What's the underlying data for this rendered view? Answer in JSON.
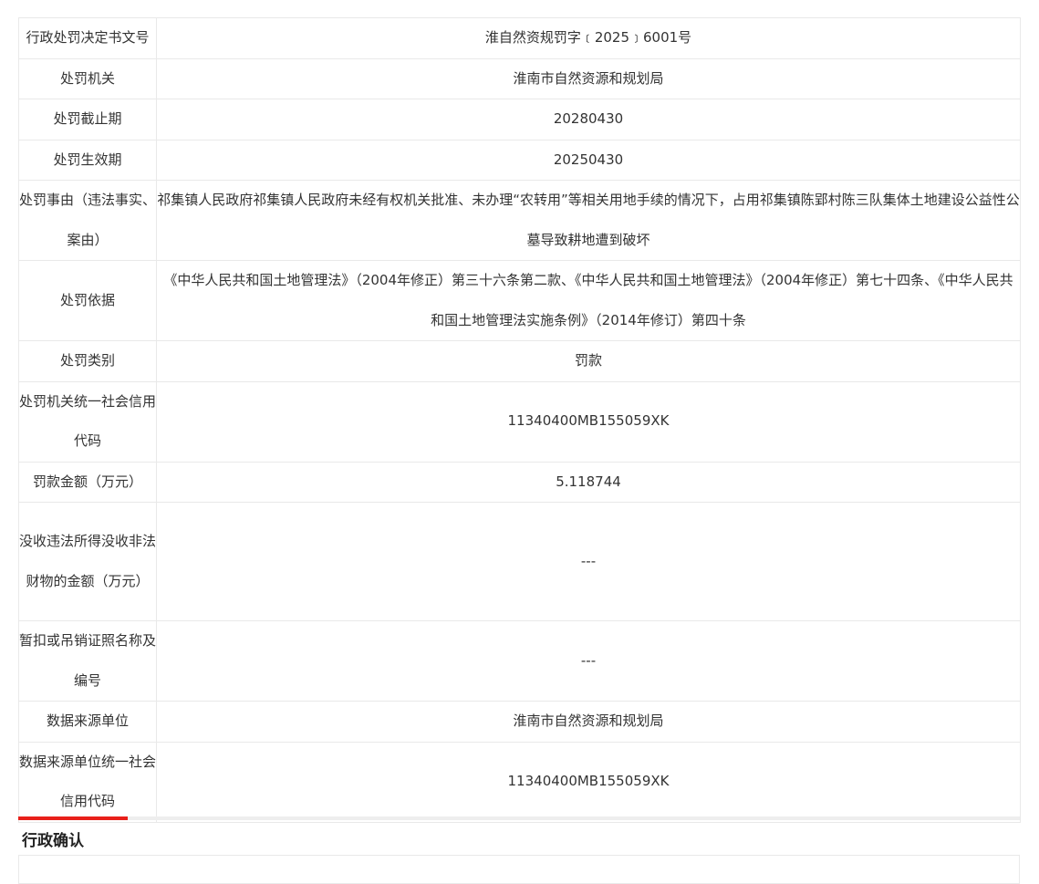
{
  "penalty_table": [
    {
      "label": "行政处罚决定书文号",
      "value": "淮自然资规罚字﹝2025﹞6001号"
    },
    {
      "label": "处罚机关",
      "value": "淮南市自然资源和规划局"
    },
    {
      "label": "处罚截止期",
      "value": "20280430"
    },
    {
      "label": "处罚生效期",
      "value": "20250430"
    },
    {
      "label": "处罚事由（违法事实、案由）",
      "value": "祁集镇人民政府祁集镇人民政府未经有权机关批准、未办理“农转用”等相关用地手续的情况下，占用祁集镇陈郢村陈三队集体土地建设公益性公墓导致耕地遭到破坏"
    },
    {
      "label": "处罚依据",
      "value": "《中华人民共和国土地管理法》（2004年修正）第三十六条第二款、《中华人民共和国土地管理法》（2004年修正）第七十四条、《中华人民共和国土地管理法实施条例》（2014年修订）第四十条"
    },
    {
      "label": "处罚类别",
      "value": "罚款"
    },
    {
      "label": "处罚机关统一社会信用代码",
      "value": "11340400MB155059XK"
    },
    {
      "label": "罚款金额（万元）",
      "value": "5.118744"
    },
    {
      "label": "没收违法所得没收非法财物的金额（万元）",
      "value": "---"
    },
    {
      "label": "暂扣或吊销证照名称及编号",
      "value": "---"
    },
    {
      "label": "数据来源单位",
      "value": "淮南市自然资源和规划局"
    },
    {
      "label": "数据来源单位统一社会信用代码",
      "value": "11340400MB155059XK"
    }
  ],
  "next_section": {
    "title": "行政确认"
  },
  "colors": {
    "accent": "#e8201a",
    "border": "#e9e9e9",
    "text": "#333333"
  }
}
